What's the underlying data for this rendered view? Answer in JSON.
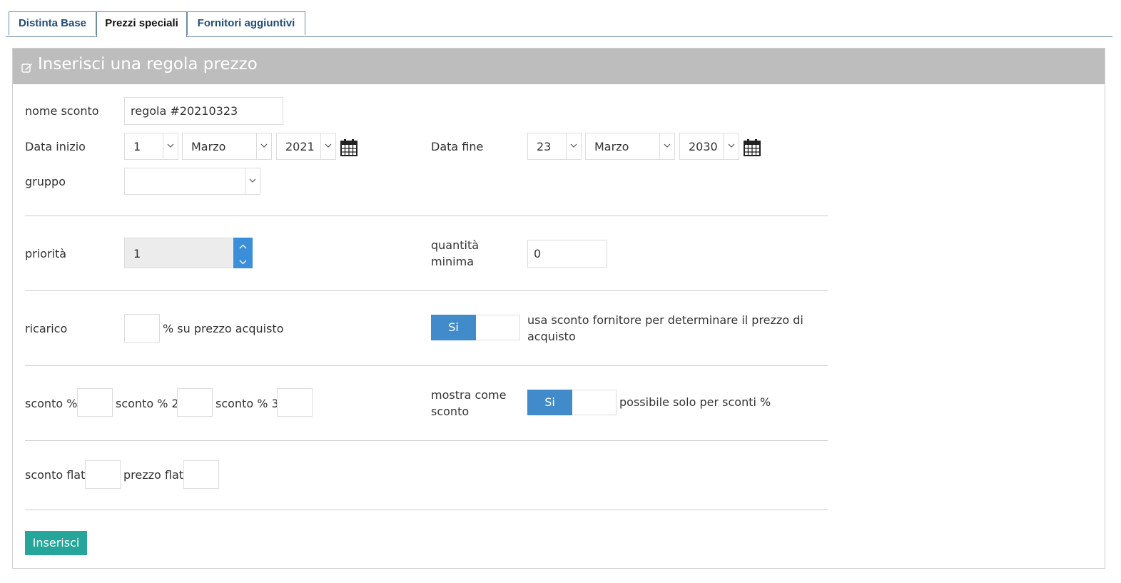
{
  "tabs": [
    {
      "label": "Distinta Base",
      "active": false
    },
    {
      "label": "Prezzi speciali",
      "active": true
    },
    {
      "label": "Fornitori aggiuntivi",
      "active": false
    }
  ],
  "panel": {
    "title": "Inserisci una regola prezzo",
    "header_color": "#bdbdbd"
  },
  "form": {
    "nome_sconto": {
      "label": "nome sconto",
      "value": "regola #20210323"
    },
    "data_inizio": {
      "label": "Data inizio",
      "day": "1",
      "month": "Marzo",
      "year": "2021"
    },
    "data_fine": {
      "label": "Data fine",
      "day": "23",
      "month": "Marzo",
      "year": "2030"
    },
    "gruppo": {
      "label": "gruppo",
      "value": ""
    },
    "priorita": {
      "label": "priorità",
      "value": "1"
    },
    "quantita_minima": {
      "label_line1": "quantità",
      "label_line2": "minima",
      "value": "0"
    },
    "ricarico": {
      "label": "ricarico",
      "suffix": "% su prezzo acquisto",
      "value": ""
    },
    "usa_sconto_fornitore": {
      "toggle_label": "Si",
      "text_line1": "usa sconto fornitore per determinare il prezzo di",
      "text_line2": "acquisto"
    },
    "sconto_pct": {
      "label": "sconto %",
      "value": ""
    },
    "sconto_pct2": {
      "label": "sconto % 2",
      "value": ""
    },
    "sconto_pct3": {
      "label": "sconto % 3",
      "value": ""
    },
    "mostra_come_sconto": {
      "label_line1": "mostra come",
      "label_line2": "sconto",
      "toggle_label": "Si",
      "note": "possibile solo per sconti %"
    },
    "sconto_flat": {
      "label": "sconto flat",
      "value": ""
    },
    "prezzo_flat": {
      "label": "prezzo flat",
      "value": ""
    },
    "submit_label": "Inserisci"
  },
  "colors": {
    "accent": "#428bca",
    "submit": "#26a69a",
    "tab_text": "#1f4e7a"
  }
}
